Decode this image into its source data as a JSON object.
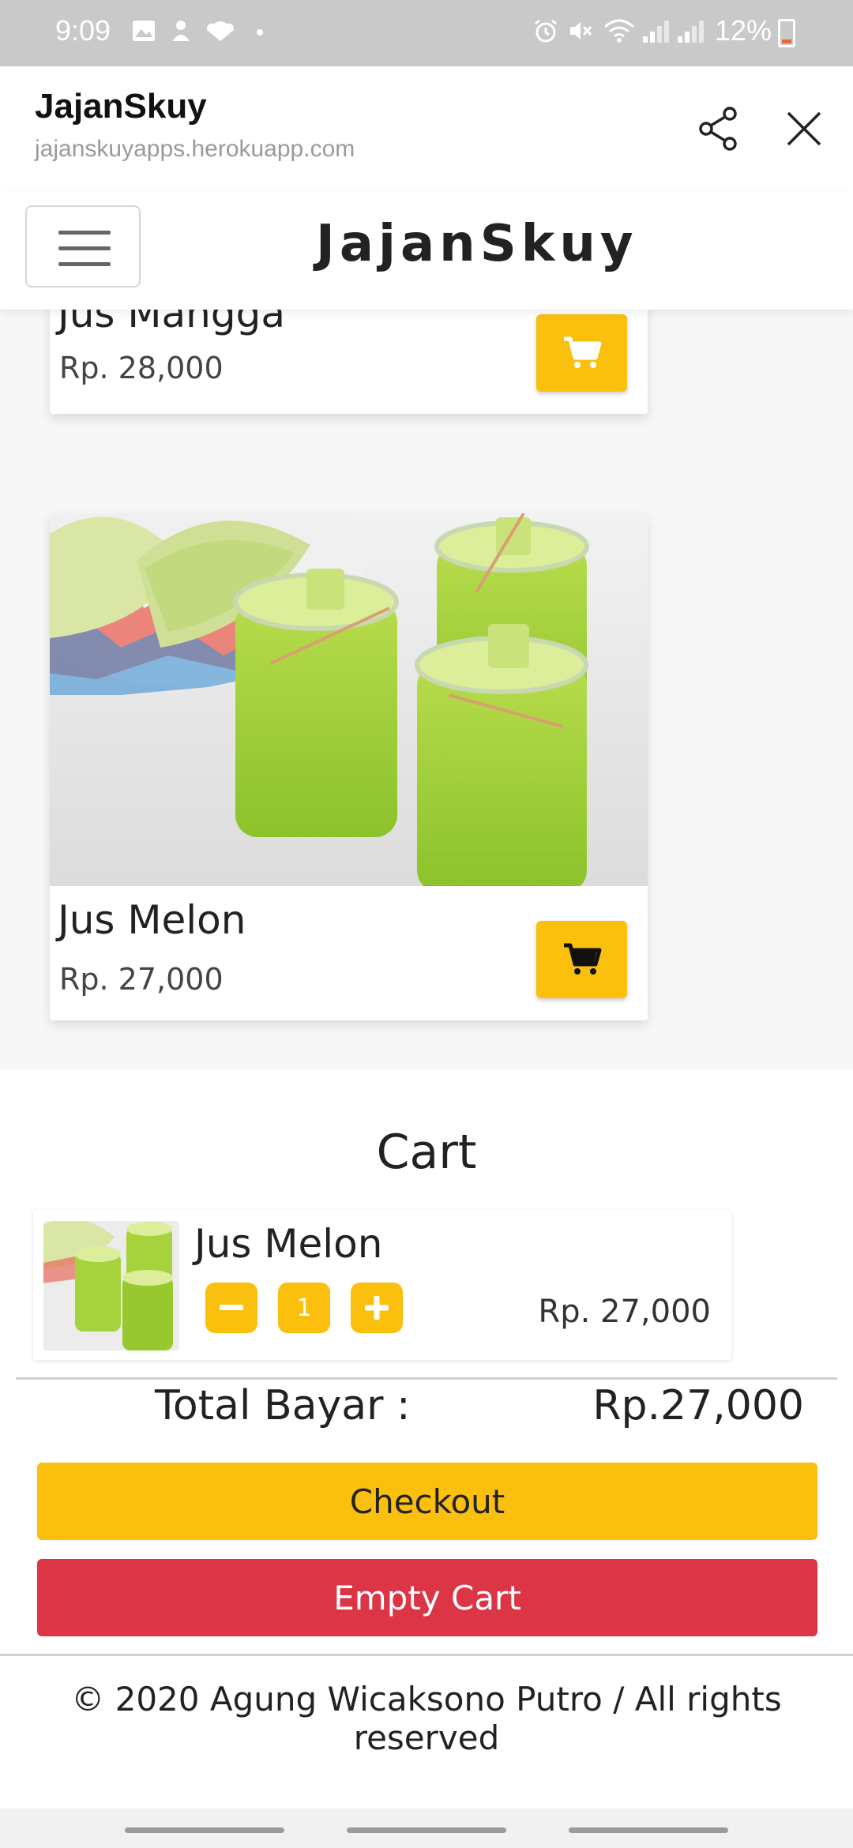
{
  "status_bar": {
    "time": "9:09",
    "battery": "12%"
  },
  "browser_tab": {
    "title": "JajanSkuy",
    "url": "jajanskuyapps.herokuapp.com"
  },
  "navbar": {
    "brand": "JajanSkuy"
  },
  "products": [
    {
      "name": "Jus Mangga",
      "price": "Rp. 28,000"
    },
    {
      "name": "Jus Melon",
      "price": "Rp. 27,000"
    }
  ],
  "cart": {
    "heading": "Cart",
    "items": [
      {
        "name": "Jus Melon",
        "quantity": "1",
        "price": "Rp. 27,000"
      }
    ],
    "total_label": "Total Bayar :",
    "total_value": "Rp.27,000",
    "checkout_label": "Checkout",
    "empty_label": "Empty Cart"
  },
  "footer": {
    "text": "© 2020 Agung Wicaksono Putro / All rights reserved"
  },
  "colors": {
    "accent_yellow": "#fbbf0e",
    "danger_red": "#dc3545"
  }
}
